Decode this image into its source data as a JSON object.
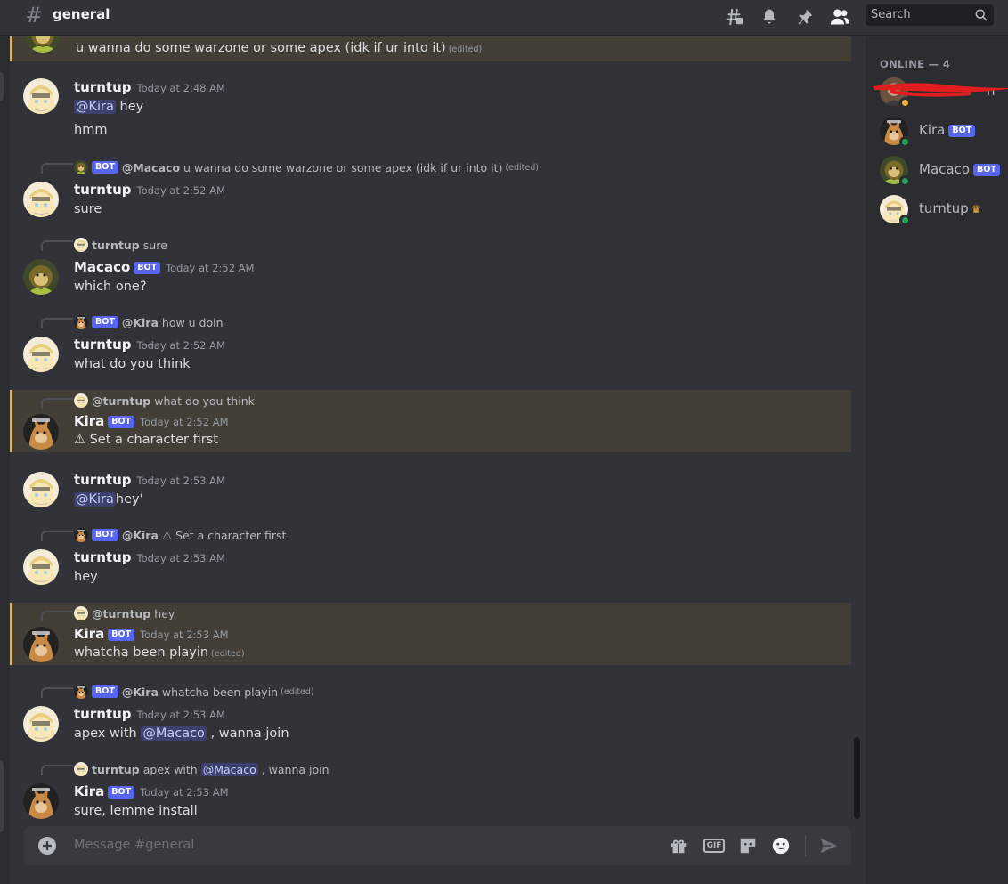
{
  "header": {
    "channel": "general",
    "search_placeholder": "Search",
    "icons": [
      "threads-icon",
      "notification-bell-icon",
      "pinned-icon",
      "member-list-icon",
      "search-icon"
    ]
  },
  "messages": [
    {
      "id": "m0",
      "highlighted": true,
      "continuation_text": "u wanna do some warzone or some apex (idk if ur into it)",
      "edited": "(edited)"
    },
    {
      "id": "m1",
      "author": "turntup",
      "timestamp": "Today at 2:48 AM",
      "line1_mention": "@Kira",
      "line1_text": "hey",
      "line2_text": "hmm"
    },
    {
      "id": "m2",
      "reply": {
        "bot_tag": "BOT",
        "name": "@Macaco",
        "text": "u wanna do some warzone or some apex (idk if ur into it)",
        "edited": "(edited)"
      },
      "author": "turntup",
      "timestamp": "Today at 2:52 AM",
      "text": "sure"
    },
    {
      "id": "m3",
      "reply": {
        "name": "turntup",
        "text": "sure"
      },
      "author": "Macaco",
      "bot_tag": "BOT",
      "timestamp": "Today at 2:52 AM",
      "text": "which one?"
    },
    {
      "id": "m4",
      "reply": {
        "bot_tag": "BOT",
        "name": "@Kira",
        "text": "how u doin"
      },
      "author": "turntup",
      "timestamp": "Today at 2:52 AM",
      "text": "what do you think"
    },
    {
      "id": "m5",
      "highlighted": true,
      "reply": {
        "name": "@turntup",
        "text": "what do you think"
      },
      "author": "Kira",
      "bot_tag": "BOT",
      "timestamp": "Today at 2:52 AM",
      "text": "⚠ Set a character first"
    },
    {
      "id": "m6",
      "author": "turntup",
      "timestamp": "Today at 2:53 AM",
      "mention": "@Kira",
      "text": "hey'"
    },
    {
      "id": "m7",
      "reply": {
        "bot_tag": "BOT",
        "name": "@Kira",
        "text": "⚠ Set a character first"
      },
      "author": "turntup",
      "timestamp": "Today at 2:53 AM",
      "text": "hey"
    },
    {
      "id": "m8",
      "highlighted": true,
      "reply": {
        "name": "@turntup",
        "text": "hey"
      },
      "author": "Kira",
      "bot_tag": "BOT",
      "timestamp": "Today at 2:53 AM",
      "text": "whatcha been playin",
      "edited": "(edited)"
    },
    {
      "id": "m9",
      "reply": {
        "bot_tag": "BOT",
        "name": "@Kira",
        "text": "whatcha been playin",
        "edited": "(edited)"
      },
      "author": "turntup",
      "timestamp": "Today at 2:53 AM",
      "text_before": "apex with",
      "mention": "@Macaco",
      "text_after": ", wanna join"
    },
    {
      "id": "m10",
      "reply": {
        "name": "turntup",
        "text_before": "apex with",
        "mention": "@Macaco",
        "text_after": ", wanna join"
      },
      "author": "Kira",
      "bot_tag": "BOT",
      "timestamp": "Today at 2:53 AM",
      "text": "sure, lemme install"
    }
  ],
  "composer": {
    "placeholder": "Message #general",
    "gif_label": "GIF",
    "icons": [
      "add-attachment-icon",
      "gift-icon",
      "gif-icon",
      "sticker-icon",
      "emoji-icon",
      "send-icon"
    ]
  },
  "members": {
    "heading": "ONLINE — 4",
    "list": [
      {
        "name": "redacted",
        "status": "idle"
      },
      {
        "name": "Kira",
        "bot_tag": "BOT",
        "status": "online"
      },
      {
        "name": "Macaco",
        "bot_tag": "BOT",
        "status": "online"
      },
      {
        "name": "turntup",
        "owner_crown": "♛",
        "status": "online"
      }
    ]
  },
  "colors": {
    "background": "#313338",
    "sidebar": "#2b2d31",
    "highlight": "#433f36",
    "highlight_bar": "#f0b232",
    "bot_tag": "#5865f2",
    "mention_bg": "#3c4270",
    "online": "#23a559",
    "idle": "#f0b232"
  }
}
